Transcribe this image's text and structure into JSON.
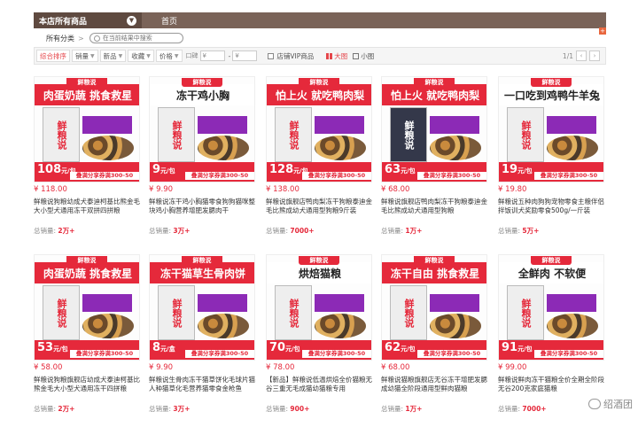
{
  "nav": {
    "all_goods": "本店所有商品",
    "home": "首页"
  },
  "crumb": {
    "category": "所有分类",
    "search_placeholder": "在当前结果中搜索"
  },
  "filters": {
    "sort": "综合排序",
    "sales": "销量",
    "new": "新品",
    "fav": "收藏",
    "price": "价格",
    "price_from": "¥",
    "price_to": "¥",
    "vip": "店铺VIP商品",
    "view_big": "大图",
    "view_small": "小图",
    "page": "1/1"
  },
  "products": [
    {
      "headline": "肉蛋奶蔬 挑食救星",
      "hlight": false,
      "badge": "108",
      "unit": "元/包",
      "price": "¥ 118.00",
      "title": "鲜粮说狗粮幼成犬泰迪柯基比熊金毛大小型犬通用冻干双拼四拼粮",
      "sales": "2万+",
      "dark": false
    },
    {
      "headline": "冻干鸡小胸",
      "hlight": true,
      "badge": "9",
      "unit": "元/包",
      "price": "¥ 9.90",
      "title": "鲜粮说冻干鸡小胸猫零食狗狗猫咪整块鸡小胸营养增肥发腮肉干",
      "sales": "3万+",
      "dark": false
    },
    {
      "headline": "怕上火 就吃鸭肉梨",
      "hlight": false,
      "badge": "128",
      "unit": "元/包",
      "price": "¥ 138.00",
      "title": "鲜粮说旗舰店鸭肉梨冻干狗粮泰迪金毛比熊成幼犬通用型狗粮9斤装",
      "sales": "7000+",
      "dark": false
    },
    {
      "headline": "怕上火 就吃鸭肉梨",
      "hlight": false,
      "badge": "63",
      "unit": "元/包",
      "price": "¥ 68.00",
      "title": "鲜粮说旗舰店鸭肉梨冻干狗粮泰迪金毛比熊成幼犬通用型狗粮",
      "sales": "1万+",
      "dark": true
    },
    {
      "headline": "一口吃到鸡鸭牛羊兔",
      "hlight": true,
      "badge": "19",
      "unit": "元/包",
      "price": "¥ 19.80",
      "title": "鲜粮说五种肉狗狗宠物零食主粮伴侣拌饭训犬奖励零食500g/一斤装",
      "sales": "5万+",
      "dark": false
    },
    {
      "headline": "肉蛋奶蔬 挑食救星",
      "hlight": false,
      "badge": "53",
      "unit": "元/包",
      "price": "¥ 58.00",
      "title": "鲜粮说狗粮旗舰店幼成犬泰迪柯基比熊金毛大小型犬通用冻干四拼粮",
      "sales": "2万+",
      "dark": false
    },
    {
      "headline": "冻干猫草生骨肉饼",
      "hlight": false,
      "badge": "8",
      "unit": "元/盒",
      "price": "¥ 9.90",
      "title": "鲜粮说生骨肉冻干猫草饼化毛球片猫人种猫草化毛营养猫零食金枪鱼",
      "sales": "3万+",
      "dark": false
    },
    {
      "headline": "烘焙猫粮",
      "hlight": true,
      "badge": "70",
      "unit": "元/包",
      "price": "¥ 78.00",
      "title": "【新品】鲜粮说低温烘焙全价猫粮无谷三重无毛成猫幼猫粮专用",
      "sales": "900+",
      "dark": false
    },
    {
      "headline": "冻干自由 挑食救星",
      "hlight": false,
      "badge": "62",
      "unit": "元/包",
      "price": "¥ 68.00",
      "title": "鲜粮说猫粮旗舰店无谷冻干增肥发腮成幼猫全阶段通用型鲜肉猫粮",
      "sales": "1万+",
      "dark": false
    },
    {
      "headline": "全鲜肉 不软便",
      "hlight": true,
      "badge": "91",
      "unit": "元/包",
      "price": "¥ 99.00",
      "title": "鲜粮说鲜肉冻干猫粮全价全期全阶段无谷200克家庭猫粮",
      "sales": "7000+",
      "dark": false
    }
  ],
  "card_common": {
    "brand": "鲜粮说",
    "coupon": "叠满分享券满300-50"
  },
  "watermark": "绍酒团"
}
